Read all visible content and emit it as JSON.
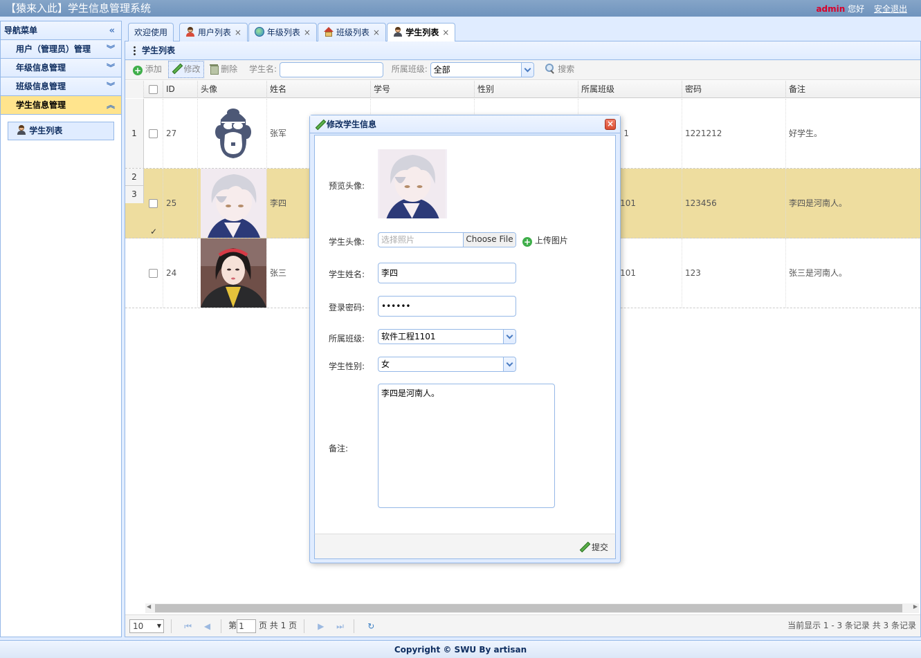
{
  "header": {
    "title": "【猿来入此】学生信息管理系统",
    "username": "admin",
    "greeting": "您好",
    "logout": "安全退出"
  },
  "nav": {
    "title": "导航菜单",
    "sections": [
      {
        "label": "用户（管理员）管理"
      },
      {
        "label": "年级信息管理"
      },
      {
        "label": "班级信息管理"
      },
      {
        "label": "学生信息管理"
      }
    ],
    "active_item": "学生列表"
  },
  "tabs": [
    {
      "label": "欢迎使用"
    },
    {
      "label": "用户列表",
      "icon": "user-icon"
    },
    {
      "label": "年级列表",
      "icon": "globe-icon"
    },
    {
      "label": "班级列表",
      "icon": "house-icon"
    },
    {
      "label": "学生列表",
      "icon": "student-icon"
    }
  ],
  "panel": {
    "title": "学生列表"
  },
  "toolbar": {
    "add": "添加",
    "edit": "修改",
    "delete": "删除",
    "name_label": "学生名:",
    "class_label": "所属班级:",
    "class_value": "全部",
    "search": "搜索"
  },
  "grid": {
    "columns": [
      "ID",
      "头像",
      "姓名",
      "学号",
      "性别",
      "所属班级",
      "密码",
      "备注"
    ],
    "row_numbers": [
      "1",
      "2",
      "3"
    ],
    "rows": [
      {
        "id": "27",
        "name": "张军",
        "class": "1",
        "password": "1221212",
        "remark": "好学生。",
        "checked": false
      },
      {
        "id": "25",
        "name": "李四",
        "class": "101",
        "password": "123456",
        "remark": "李四是河南人。",
        "checked": true
      },
      {
        "id": "24",
        "name": "张三",
        "class": "101",
        "password": "123",
        "remark": "张三是河南人。",
        "checked": false
      }
    ]
  },
  "pager": {
    "page_size": "10",
    "page_prefix": "第",
    "page_value": "1",
    "page_suffix": "页 共 1 页",
    "info": "当前显示 1 - 3 条记录 共 3 条记录"
  },
  "dialog": {
    "title": "修改学生信息",
    "preview_label": "预览头像:",
    "photo_label": "学生头像:",
    "photo_placeholder": "选择照片",
    "choose_file": "Choose File",
    "upload": "上传图片",
    "name_label": "学生姓名:",
    "name_value": "李四",
    "password_label": "登录密码:",
    "password_value": "••••••",
    "class_label": "所属班级:",
    "class_value": "软件工程1101",
    "gender_label": "学生性别:",
    "gender_value": "女",
    "remark_label": "备注:",
    "remark_value": "李四是河南人。",
    "submit": "提交"
  },
  "footer": {
    "text": "Copyright © SWU By artisan"
  }
}
